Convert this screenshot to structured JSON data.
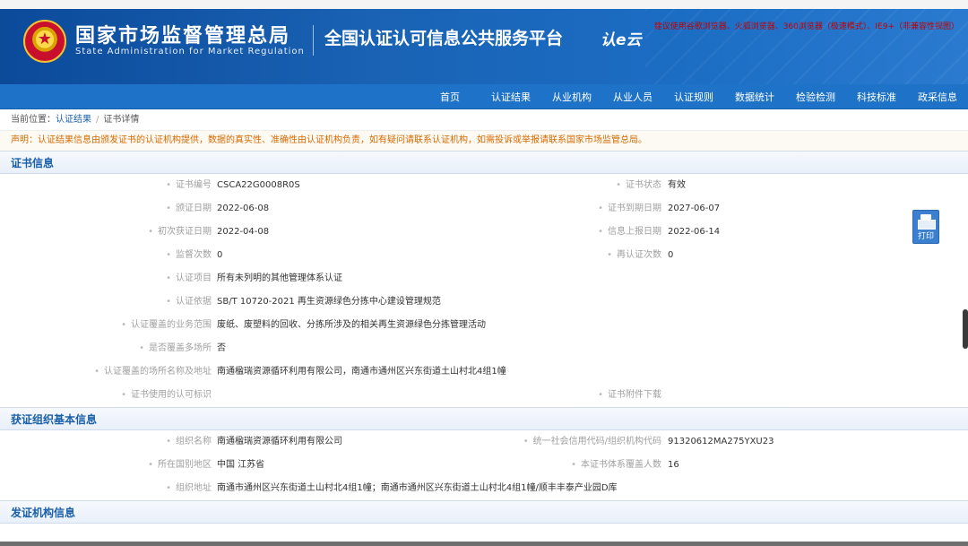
{
  "browser_tip": "建议使用谷歌浏览器、火狐浏览器、360浏览器（极速模式）、IE9+（非兼容性视图）",
  "header": {
    "agency_cn": "国家市场监督管理总局",
    "agency_en": "State Administration for Market Regulation",
    "platform": "全国认证认可信息公共服务平台",
    "logo_text": "认e云"
  },
  "nav": [
    "首页",
    "认证结果",
    "从业机构",
    "从业人员",
    "认证规则",
    "数据统计",
    "检验检测",
    "科技标准",
    "政采信息"
  ],
  "breadcrumb": {
    "prefix": "当前位置：",
    "items": [
      "认证结果",
      "证书详情"
    ],
    "sep": "/"
  },
  "notice": "声明：认证结果信息由颁发证书的认证机构提供，数据的真实性、准确性由认证机构负责，如有疑问请联系认证机构，如需投诉或举报请联系国家市场监管总局。",
  "cert_section": {
    "title": "证书信息",
    "rows": [
      {
        "l_label": "证书编号",
        "l_value": "CSCA22G0008R0S",
        "r_label": "证书状态",
        "r_value": "有效"
      },
      {
        "l_label": "颁证日期",
        "l_value": "2022-06-08",
        "r_label": "证书到期日期",
        "r_value": "2027-06-07"
      },
      {
        "l_label": "初次获证日期",
        "l_value": "2022-04-08",
        "r_label": "信息上报日期",
        "r_value": "2022-06-14"
      },
      {
        "l_label": "监督次数",
        "l_value": "0",
        "r_label": "再认证次数",
        "r_value": "0"
      },
      {
        "l_label": "认证项目",
        "l_value": "所有未列明的其他管理体系认证"
      },
      {
        "l_label": "认证依据",
        "l_value": "SB/T 10720-2021 再生资源绿色分拣中心建设管理规范"
      },
      {
        "l_label": "认证覆盖的业务范围",
        "l_value": "废纸、废塑料的回收、分拣所涉及的相关再生资源绿色分拣管理活动"
      },
      {
        "l_label": "是否覆盖多场所",
        "l_value": "否"
      },
      {
        "l_label": "认证覆盖的场所名称及地址",
        "l_value": "南通楹瑞资源循环利用有限公司，南通市通州区兴东街道土山村北4组1幢"
      },
      {
        "l_label": "证书使用的认可标识",
        "l_value": "",
        "r_label": "证书附件下载",
        "r_value": ""
      }
    ],
    "print_label": "打印"
  },
  "org_section": {
    "title": "获证组织基本信息",
    "rows": [
      {
        "l_label": "组织名称",
        "l_value": "南通楹瑞资源循环利用有限公司",
        "r_label": "统一社会信用代码/组织机构代码",
        "r_value": "91320612MA275YXU23"
      },
      {
        "l_label": "所在国别地区",
        "l_value": "中国 江苏省",
        "r_label": "本证书体系覆盖人数",
        "r_value": "16"
      },
      {
        "l_label": "组织地址",
        "l_value": "南通市通州区兴东街道土山村北4组1幢；南通市通州区兴东街道土山村北4组1幢/顺丰丰泰产业园D库"
      }
    ]
  },
  "issuer_section": {
    "title": "发证机构信息"
  }
}
